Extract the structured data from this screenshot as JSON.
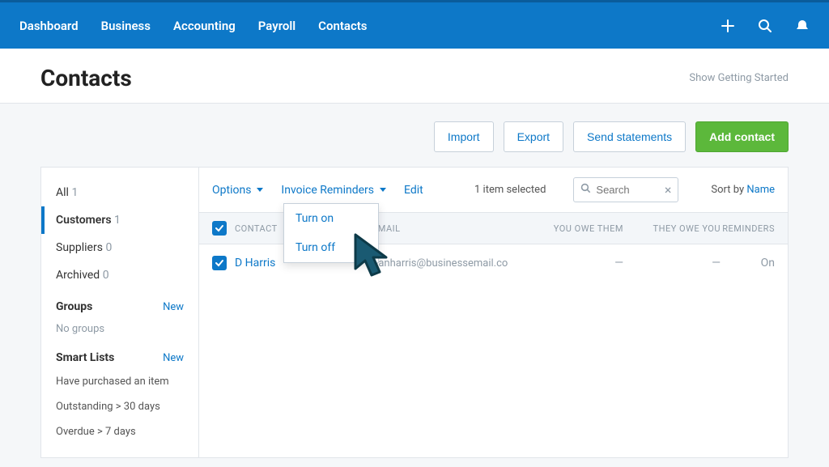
{
  "nav": {
    "items": [
      "Dashboard",
      "Business",
      "Accounting",
      "Payroll",
      "Contacts"
    ],
    "active": 4
  },
  "page": {
    "title": "Contacts",
    "getting_started": "Show Getting Started"
  },
  "actions": {
    "import": "Import",
    "export": "Export",
    "send_statements": "Send statements",
    "add_contact": "Add contact"
  },
  "sidebar": {
    "filters": [
      {
        "label": "All",
        "count": "1",
        "active": false
      },
      {
        "label": "Customers",
        "count": "1",
        "active": true
      },
      {
        "label": "Suppliers",
        "count": "0",
        "active": false
      },
      {
        "label": "Archived",
        "count": "0",
        "active": false
      }
    ],
    "groups": {
      "heading": "Groups",
      "new": "New",
      "empty": "No groups"
    },
    "smart": {
      "heading": "Smart Lists",
      "new": "New",
      "items": [
        "Have purchased an item",
        "Outstanding > 30 days",
        "Overdue > 7 days"
      ]
    }
  },
  "toolbar": {
    "options": "Options",
    "invoice_reminders": "Invoice Reminders",
    "edit": "Edit",
    "selected": "1 item selected",
    "search_placeholder": "Search",
    "sort_label": "Sort by ",
    "sort_value": "Name"
  },
  "dropdown": {
    "turn_on": "Turn on",
    "turn_off": "Turn off"
  },
  "table": {
    "headers": {
      "contact": "CONTACT",
      "email": "EMAIL",
      "you_owe": "YOU OWE THEM",
      "they_owe": "THEY OWE YOU",
      "reminders": "REMINDERS"
    },
    "rows": [
      {
        "name": "D Harris",
        "email": "danharris@businessemail.co",
        "you_owe": "—",
        "they_owe": "—",
        "reminders": "On"
      }
    ]
  }
}
